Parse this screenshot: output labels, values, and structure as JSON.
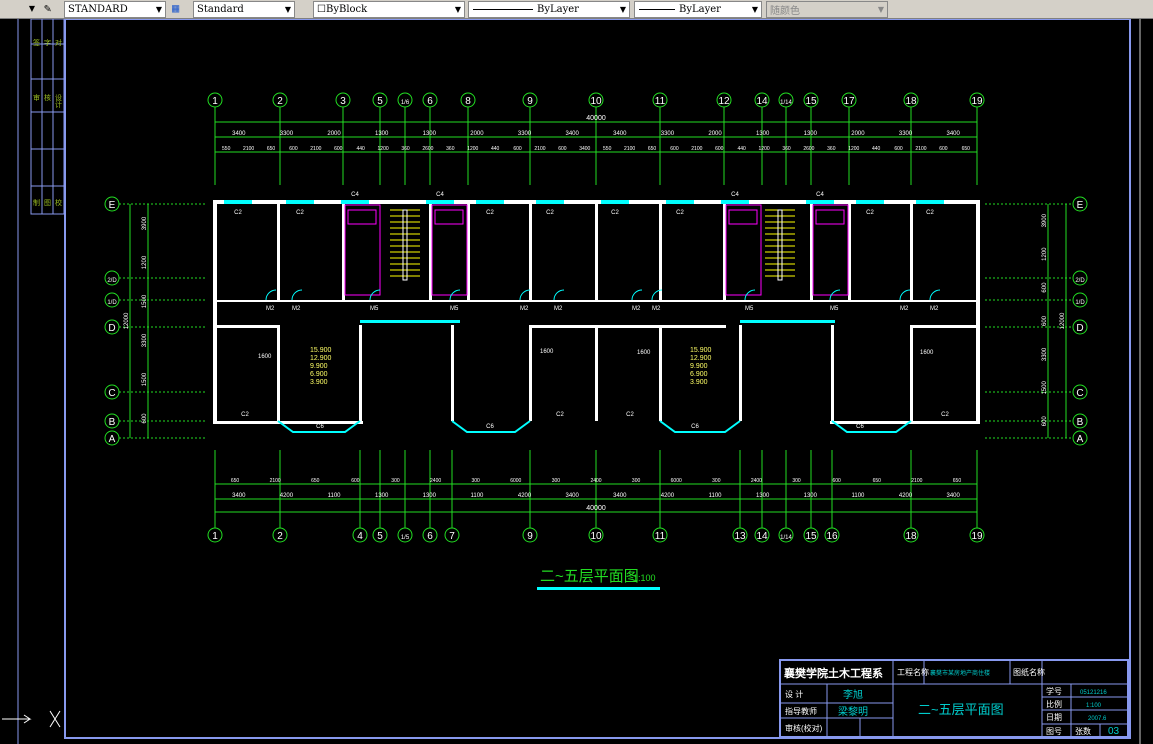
{
  "toolbar": {
    "text_style": "STANDARD",
    "dim_style": "Standard",
    "color": "ByBlock",
    "linetype": "ByLayer",
    "lineweight": "ByLayer",
    "plot_style": "随颜色"
  },
  "colors": {
    "axis": "#22dd22",
    "wall": "#ffffff",
    "window": "#00ffff",
    "frame": "#8899ee",
    "fixture": "#ff00ff",
    "stair": "#ffff00"
  },
  "axes_top": [
    "1",
    "2",
    "3",
    "5",
    "1/6",
    "6",
    "8",
    "9",
    "10",
    "11",
    "12",
    "14",
    "1/14",
    "15",
    "17",
    "18",
    "19"
  ],
  "axes_bottom": [
    "1",
    "2",
    "4",
    "5",
    "1/5",
    "6",
    "7",
    "9",
    "10",
    "11",
    "13",
    "14",
    "1/14",
    "15",
    "16",
    "18",
    "19"
  ],
  "axes_side": [
    "E",
    "2/D",
    "1/D",
    "D",
    "C",
    "B",
    "A"
  ],
  "dims_top": {
    "total": "40000",
    "row2": [
      "3400",
      "3300",
      "2000",
      "1300",
      "1300",
      "2000",
      "3300",
      "3400",
      "3400",
      "3300",
      "2000",
      "1300",
      "1300",
      "2000",
      "3300",
      "3400"
    ],
    "row3": [
      "550",
      "2100",
      "650",
      "600",
      "2100",
      "600",
      "440",
      "1200",
      "360",
      "2600",
      "360",
      "1200",
      "440",
      "600",
      "2100",
      "600",
      "3400",
      "550",
      "2100",
      "650",
      "600",
      "2100",
      "600",
      "440",
      "1200",
      "360",
      "2600",
      "360",
      "1200",
      "440",
      "600",
      "2100",
      "600",
      "650"
    ]
  },
  "dims_bottom": {
    "total": "40000",
    "row2": [
      "3400",
      "4200",
      "1100",
      "1300",
      "1300",
      "1100",
      "4200",
      "3400",
      "3400",
      "4200",
      "1100",
      "1300",
      "1300",
      "1100",
      "4200",
      "3400"
    ],
    "row1": [
      "650",
      "2100",
      "650",
      "600",
      "300",
      "2400",
      "300",
      "6000",
      "300",
      "2400",
      "300",
      "6000",
      "300",
      "2400",
      "300",
      "600",
      "650",
      "2100",
      "650"
    ]
  },
  "dims_left": {
    "total": "12000",
    "parts": [
      "3900",
      "1200",
      "1500",
      "3300",
      "1500",
      "600"
    ]
  },
  "dims_right": {
    "total": "12000",
    "parts": [
      "3900",
      "1200",
      "600",
      "600",
      "3300",
      "1500",
      "600"
    ]
  },
  "elevations": [
    "15.900",
    "12.900",
    "9.900",
    "6.900",
    "3.900"
  ],
  "window_labels": [
    "C2",
    "C2",
    "C4",
    "C4",
    "C2",
    "C2",
    "C2",
    "C2",
    "C4",
    "C4",
    "C2",
    "C2"
  ],
  "bottom_windows": [
    "C2",
    "C6",
    "C6",
    "C2",
    "C2",
    "C6",
    "C6",
    "C2"
  ],
  "door_labels": [
    "M2",
    "M2",
    "M5",
    "M5",
    "M2",
    "M2",
    "M2",
    "M2",
    "M5",
    "M5",
    "M2",
    "M2"
  ],
  "dim_note": "1600",
  "drawing_title": "二~五层平面图",
  "drawing_scale": "1:100",
  "title_block": {
    "school": "襄樊学院土木工程系",
    "project_label": "工程名称",
    "project": "襄樊市某房地产商住楼",
    "drawing_label": "图纸名称",
    "designer_label": "设  计",
    "designer": "李旭",
    "advisor_label": "指导教师",
    "advisor": "梁黎明",
    "review_label": "审核(校对)",
    "title": "二~五层平面图",
    "no_label": "学号",
    "no": "05121216",
    "scale_label": "比例",
    "scale": "1:100",
    "date_label": "日期",
    "date": "2007.6",
    "sheet_label": "图号",
    "count_label": "张数",
    "sheet": "03"
  },
  "side_panel": [
    "签",
    "字",
    "审",
    "核",
    "设计",
    "制",
    "图",
    "校",
    "对"
  ]
}
